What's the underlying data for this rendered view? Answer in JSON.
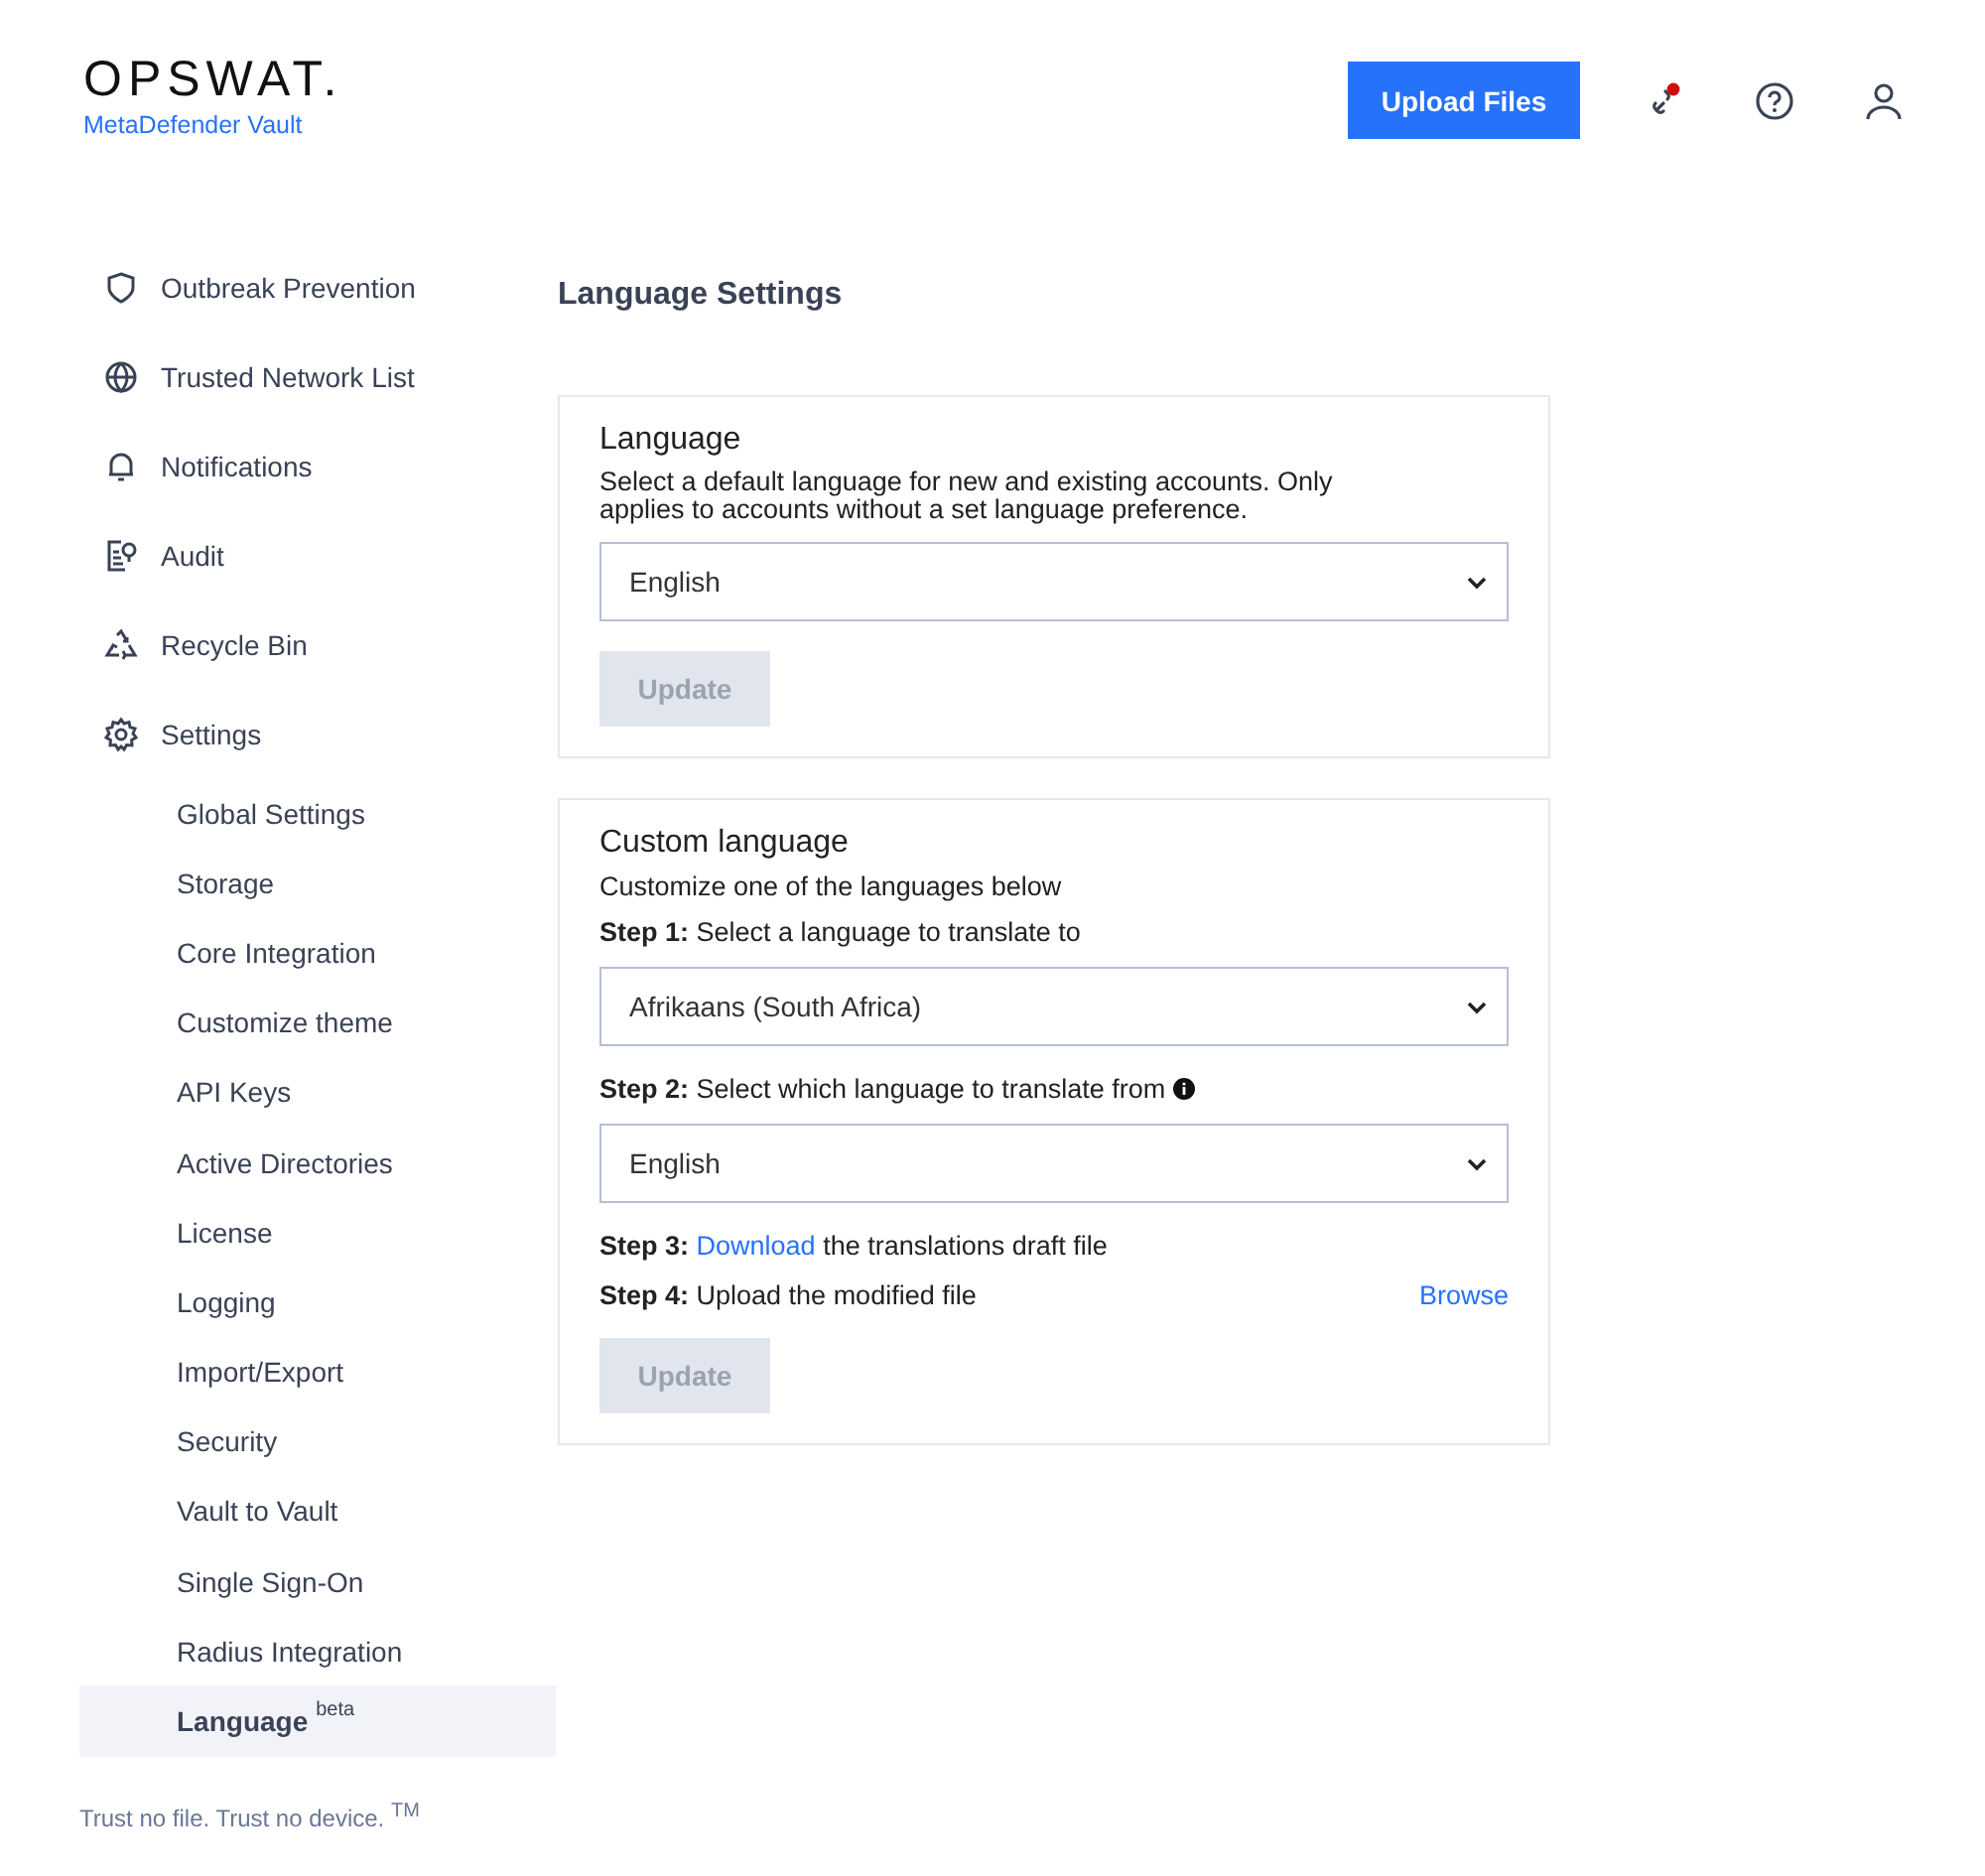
{
  "header": {
    "logo": "OPSWAT.",
    "product": "MetaDefender Vault",
    "upload_button": "Upload Files",
    "notification_unread": true
  },
  "sidebar": {
    "items": [
      {
        "label": "Outbreak Prevention",
        "kind": "shield",
        "selected": false
      },
      {
        "label": "Trusted Network List",
        "kind": "globe",
        "selected": false
      },
      {
        "label": "Notifications",
        "kind": "bell",
        "selected": false
      },
      {
        "label": "Audit",
        "kind": "audit",
        "selected": false
      },
      {
        "label": "Recycle Bin",
        "kind": "recycle",
        "selected": false
      },
      {
        "label": "Settings",
        "kind": "gear",
        "selected": false,
        "children": [
          {
            "label": "Global Settings",
            "selected": false
          },
          {
            "label": "Storage",
            "selected": false
          },
          {
            "label": "Core Integration",
            "selected": false
          },
          {
            "label": "Customize theme",
            "selected": false
          },
          {
            "label": "API Keys",
            "selected": false
          },
          {
            "label": "Active Directories",
            "selected": false
          },
          {
            "label": "License",
            "selected": false
          },
          {
            "label": "Logging",
            "selected": false
          },
          {
            "label": "Import/Export",
            "selected": false
          },
          {
            "label": "Security",
            "selected": false
          },
          {
            "label": "Vault to Vault",
            "selected": false
          },
          {
            "label": "Single Sign-On",
            "selected": false
          },
          {
            "label": "Radius Integration",
            "selected": false
          },
          {
            "label": "Language",
            "badge": "beta",
            "selected": true
          }
        ]
      }
    ],
    "footer": "Trust no file. Trust no device. $^{TM}$"
  },
  "page_title": "Language Settings",
  "language_card": {
    "title": "Language",
    "description": "Select a default language for new and existing accounts. Only applies to accounts without a set language preference.",
    "select_value": "English",
    "button": "Update",
    "button_disabled": true
  },
  "custom_card": {
    "title": "Custom language",
    "description": "Customize one of the languages below",
    "steps": [
      {
        "kind": "select",
        "label": "Step 1:",
        "text": "Select a language to translate to",
        "select_value": "Afrikaans (South Africa)"
      },
      {
        "kind": "select",
        "label": "Step 2:",
        "text": "Select which language to translate from",
        "info": true,
        "select_value": "English"
      },
      {
        "kind": "link",
        "label": "Step 3:",
        "link": "Download",
        "text": "the translations draft file"
      },
      {
        "kind": "browse",
        "label": "Step 4:",
        "text": "Upload the modified file",
        "action": "Browse"
      }
    ],
    "button": "Update",
    "button_disabled": true
  }
}
